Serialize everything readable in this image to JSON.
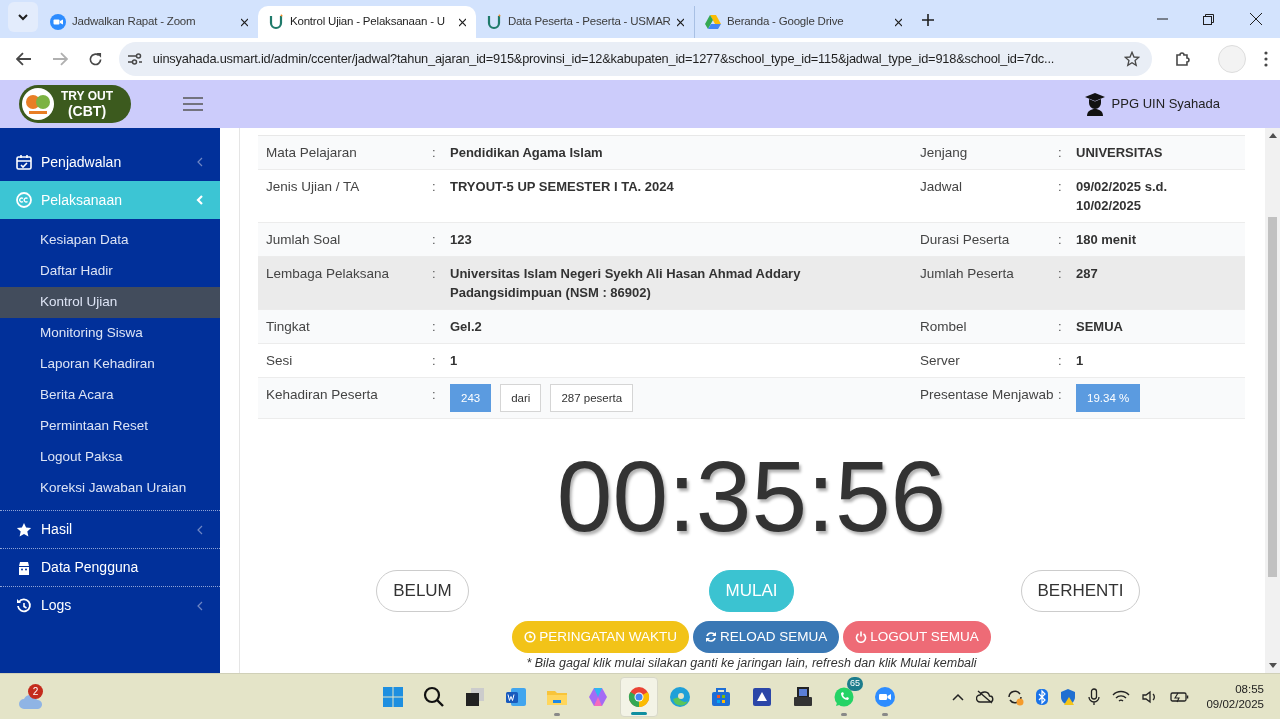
{
  "browser": {
    "tabs": [
      {
        "title": "Jadwalkan Rapat - Zoom",
        "kind": "zoom",
        "selected": false
      },
      {
        "title": "Kontrol Ujian - Pelaksanaan - U",
        "kind": "u",
        "selected": true
      },
      {
        "title": "Data Peserta - Peserta - USMAR",
        "kind": "u",
        "selected": false
      },
      {
        "title": "Beranda - Google Drive",
        "kind": "drive",
        "selected": false
      }
    ],
    "url": "uinsyahada.usmart.id/admin/ccenter/jadwal?tahun_ajaran_id=915&provinsi_id=12&kabupaten_id=1277&school_type_id=115&jadwal_type_id=918&school_id=7dc..."
  },
  "header": {
    "logo_line1": "TRY OUT",
    "logo_line2": "(CBT)",
    "user": "PPG UIN Syahada"
  },
  "sidebar": {
    "items": [
      {
        "label": "Penjadwalan",
        "kind": "calendar",
        "expanded": false,
        "selected": false
      },
      {
        "label": "Pelaksanaan",
        "kind": "cc",
        "expanded": true,
        "selected": true,
        "children": [
          {
            "label": "Kesiapan Data",
            "selected": false
          },
          {
            "label": "Daftar Hadir",
            "selected": false
          },
          {
            "label": "Kontrol Ujian",
            "selected": true
          },
          {
            "label": "Monitoring Siswa",
            "selected": false
          },
          {
            "label": "Laporan Kehadiran",
            "selected": false
          },
          {
            "label": "Berita Acara",
            "selected": false
          },
          {
            "label": "Permintaan Reset",
            "selected": false
          },
          {
            "label": "Logout Paksa",
            "selected": false
          },
          {
            "label": "Koreksi Jawaban Uraian",
            "selected": false
          }
        ]
      },
      {
        "label": "Hasil",
        "kind": "star",
        "expanded": false,
        "selected": false
      },
      {
        "label": "Data Pengguna",
        "kind": "user",
        "selected": false
      },
      {
        "label": "Logs",
        "kind": "history",
        "expanded": false,
        "selected": false
      }
    ]
  },
  "info_rows": [
    {
      "highlighted": false,
      "left": {
        "label": "Mata Pelajaran",
        "value": "Pendidikan Agama Islam"
      },
      "right": {
        "label": "Jenjang",
        "value": "UNIVERSITAS"
      }
    },
    {
      "highlighted": false,
      "left": {
        "label": "Jenis Ujian / TA",
        "value": "TRYOUT-5 UP SEMESTER I TA. 2024"
      },
      "right": {
        "label": "Jadwal",
        "value": "09/02/2025 s.d. 10/02/2025"
      }
    },
    {
      "highlighted": false,
      "left": {
        "label": "Jumlah Soal",
        "value": "123"
      },
      "right": {
        "label": "Durasi Peserta",
        "value": "180 menit"
      }
    },
    {
      "highlighted": true,
      "left": {
        "label": "Lembaga Pelaksana",
        "value": "Universitas Islam Negeri Syekh Ali Hasan Ahmad Addary Padangsidimpuan (NSM : 86902)"
      },
      "right": {
        "label": "Jumlah Peserta",
        "value": "287"
      }
    },
    {
      "highlighted": false,
      "left": {
        "label": "Tingkat",
        "value": "Gel.2"
      },
      "right": {
        "label": "Rombel",
        "value": "SEMUA"
      }
    },
    {
      "highlighted": false,
      "left": {
        "label": "Sesi",
        "value": "1"
      },
      "right": {
        "label": "Server",
        "value": "1"
      }
    },
    {
      "highlighted": false,
      "left": {
        "label": "Kehadiran Peserta",
        "badges": [
          {
            "text": "243",
            "kind": "primary"
          },
          {
            "text": "dari",
            "kind": "plain"
          },
          {
            "text": "287 peserta",
            "kind": "plain"
          }
        ]
      },
      "right": {
        "label": "Presentase Menjawab",
        "badges": [
          {
            "text": "19.34 %",
            "kind": "primary"
          }
        ]
      }
    }
  ],
  "separator": ":",
  "timer": "00:35:56",
  "status_buttons": [
    {
      "label": "BELUM",
      "selected": false
    },
    {
      "label": "MULAI",
      "selected": true
    },
    {
      "label": "BERHENTI",
      "selected": false
    }
  ],
  "actions": [
    {
      "label": "PERINGATAN WAKTU",
      "kind": "warning"
    },
    {
      "label": "RELOAD SEMUA",
      "kind": "reload"
    },
    {
      "label": "LOGOUT SEMUA",
      "kind": "logout"
    }
  ],
  "note": "* Bila gagal klik mulai silakan ganti ke jaringan lain, refresh dan klik Mulai kembali",
  "taskbar": {
    "weather_badge": "2",
    "apps": [
      {
        "kind": "start",
        "running": false,
        "active": false
      },
      {
        "kind": "search",
        "running": false,
        "active": false
      },
      {
        "kind": "taskview",
        "running": false,
        "active": false
      },
      {
        "kind": "word",
        "running": false,
        "active": false
      },
      {
        "kind": "explorer",
        "running": true,
        "active": false
      },
      {
        "kind": "copilot",
        "running": false,
        "active": false
      },
      {
        "kind": "chrome",
        "running": true,
        "active": true
      },
      {
        "kind": "edge",
        "running": false,
        "active": false
      },
      {
        "kind": "store",
        "running": false,
        "active": false
      },
      {
        "kind": "scanner",
        "running": false,
        "active": false
      },
      {
        "kind": "printer",
        "running": false,
        "active": false
      },
      {
        "kind": "whatsapp",
        "running": true,
        "active": false,
        "badge": "65"
      },
      {
        "kind": "zoom",
        "running": true,
        "active": false
      }
    ],
    "time": "08:55",
    "date": "09/02/2025"
  }
}
